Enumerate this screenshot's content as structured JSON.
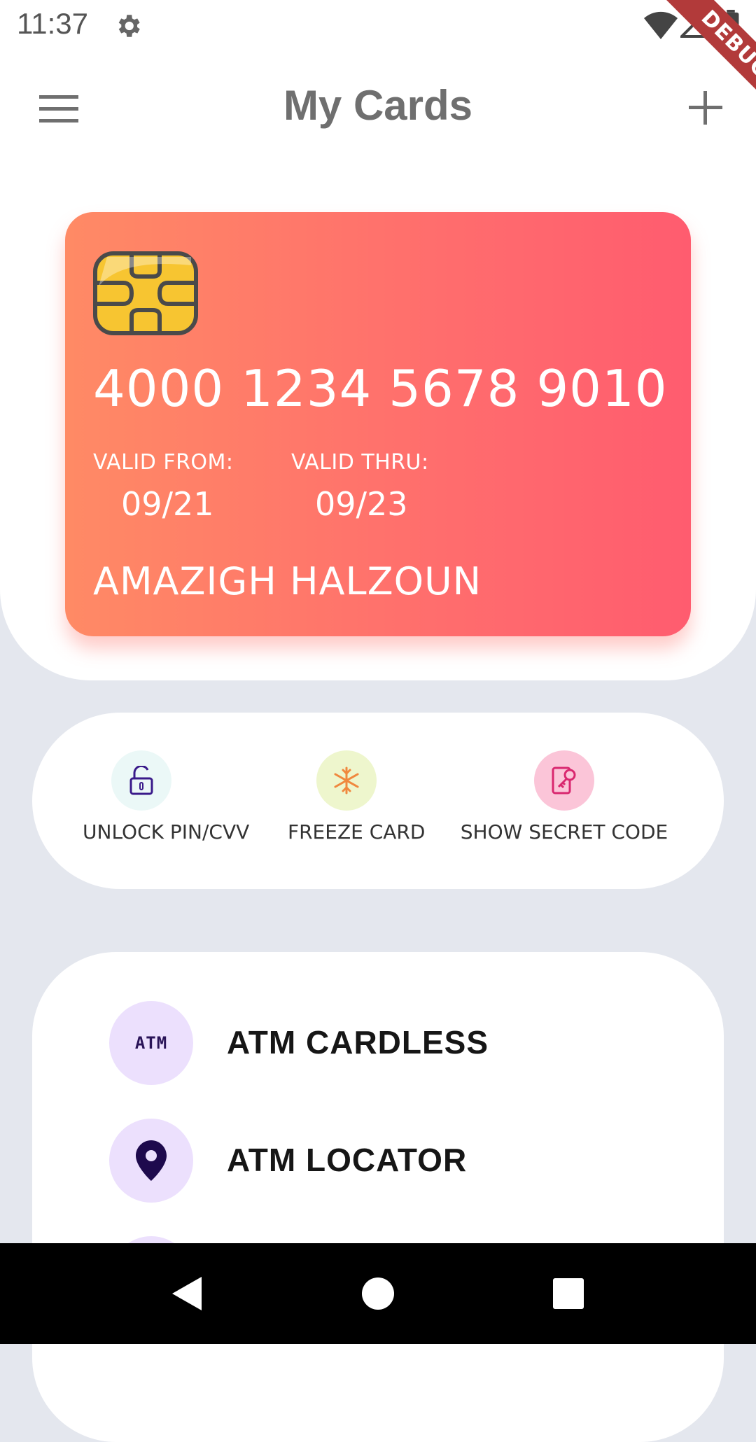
{
  "status_bar": {
    "time": "11:37",
    "debug_label": "DEBUG"
  },
  "app_bar": {
    "title": "My Cards"
  },
  "card": {
    "number": "4000 1234 5678 9010",
    "valid_from_label": "VALID FROM:",
    "valid_from": "09/21",
    "valid_thru_label": "VALID THRU:",
    "valid_thru": "09/23",
    "holder": "AMAZIGH HALZOUN",
    "gradient_start": "#ff8a65",
    "gradient_end": "#ff5c6f"
  },
  "actions": [
    {
      "label": "UNLOCK PIN/CVV",
      "icon": "lock-icon",
      "color": "#ebf8f7"
    },
    {
      "label": "FREEZE CARD",
      "icon": "snowflake-icon",
      "color": "#eef6cd"
    },
    {
      "label": "SHOW SECRET CODE",
      "icon": "key-icon",
      "color": "#fbc5d8"
    }
  ],
  "menu": [
    {
      "label": "ATM CARDLESS",
      "icon_text": "ATM",
      "icon": "atm-icon"
    },
    {
      "label": "ATM LOCATOR",
      "icon": "location-pin-icon"
    }
  ]
}
